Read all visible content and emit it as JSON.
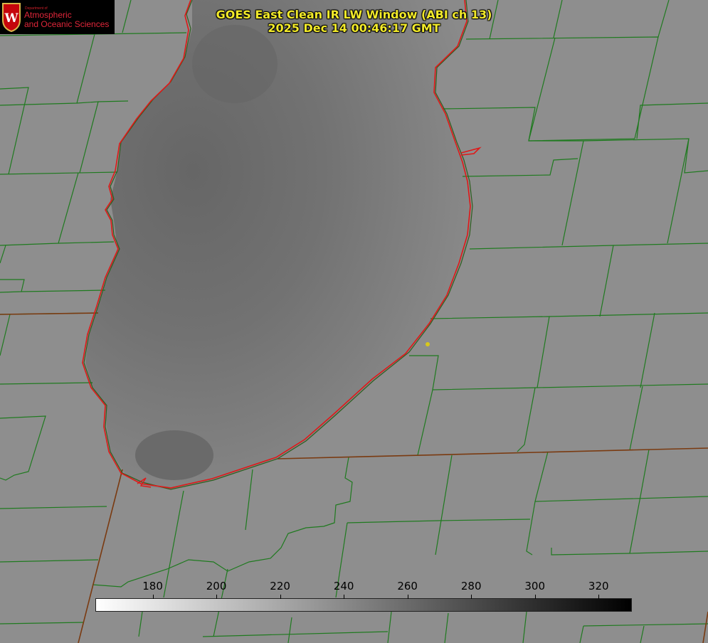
{
  "title": {
    "line1": "GOES East Clean IR LW Window (ABI ch 13)",
    "line2": "2025 Dec 14 00:46:17 GMT"
  },
  "logo": {
    "dept": "Department of",
    "line1": "Atmospheric",
    "line2": "and Oceanic Sciences",
    "seal_letter": "W"
  },
  "colorbar": {
    "min": 162,
    "max": 330,
    "ticks": [
      180,
      200,
      220,
      240,
      260,
      280,
      300,
      320
    ],
    "from_color": "#ffffff",
    "to_color": "#000000"
  },
  "colors": {
    "land": "#8e8e8e",
    "lake_dark": "#6b6b6b",
    "county_lines": "#1f7a1f",
    "shoreline": "#e01818",
    "state_line": "#7a3a10",
    "title": "#f2ea2a",
    "marker": "#d8c81a"
  }
}
